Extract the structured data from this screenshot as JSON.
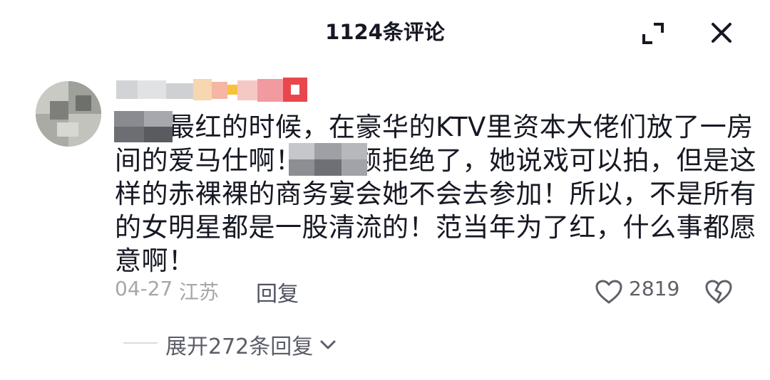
{
  "header": {
    "title": "1124条评论"
  },
  "icons": {
    "expand": "expand-corners-icon",
    "close": "close-x-icon",
    "like": "heart-outline-icon",
    "dislike": "broken-heart-icon",
    "chevron": "chevron-down-icon"
  },
  "comment": {
    "lines": [
      "丽颖最红的时候，在豪华的KTV里资本大佬们放了一房",
      "间的爱马仕啊！被丽颖拒绝了，她说戏可以拍，但是这",
      "样的赤裸裸的商务宴会她不会去参加！所以，不是所有",
      "的女明星都是一股清流的！范当年为了红，什么事都愿",
      "意啊！"
    ],
    "date": "04-27",
    "location": "江苏",
    "reply_label": "回复",
    "like_count": "2819",
    "expand_replies_label": "展开272条回复"
  },
  "colors": {
    "text": "#161823",
    "meta": "#a6a7ab",
    "secondary": "#5b5d67"
  }
}
